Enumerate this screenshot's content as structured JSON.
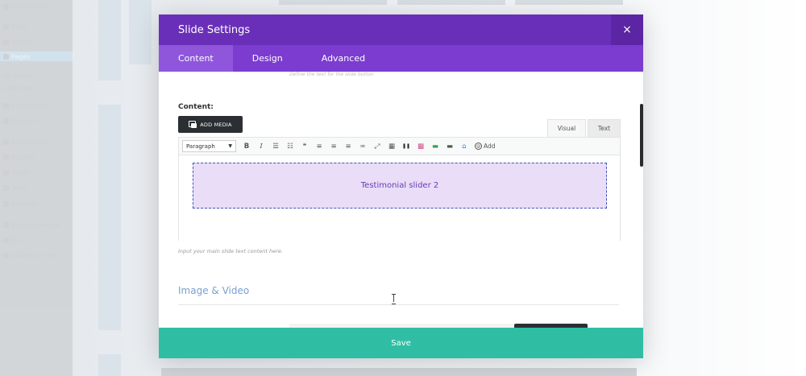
{
  "wp_menu": [
    {
      "label": "Dashboard"
    },
    {
      "label": "Posts"
    },
    {
      "label": "Media"
    },
    {
      "label": "Pages"
    },
    {
      "label": "All Pages"
    },
    {
      "label": "Add New"
    },
    {
      "label": "Comments"
    },
    {
      "label": "Projects"
    },
    {
      "label": "Appearance"
    },
    {
      "label": "Plugins"
    },
    {
      "label": "Users"
    },
    {
      "label": "Tools"
    },
    {
      "label": "Settings"
    },
    {
      "label": "WooCommerce"
    },
    {
      "label": "Divi"
    },
    {
      "label": "Collapse menu"
    }
  ],
  "modal": {
    "title": "Slide Settings",
    "close_glyph": "×",
    "tabs": [
      {
        "label": "Content"
      },
      {
        "label": "Design"
      },
      {
        "label": "Advanced"
      }
    ],
    "faded_description": "Define the text for the slide button",
    "content_label": "Content:",
    "add_media_label": "ADD MEDIA",
    "editor_tabs": {
      "visual": "Visual",
      "text": "Text"
    },
    "toolbar": {
      "format_select": "Paragraph",
      "buttons": [
        {
          "name": "bold-icon",
          "glyph": "B"
        },
        {
          "name": "italic-icon",
          "glyph": "I"
        },
        {
          "name": "bullet-list-icon",
          "glyph": "☰"
        },
        {
          "name": "numbered-list-icon",
          "glyph": "☷"
        },
        {
          "name": "blockquote-icon",
          "glyph": "❝"
        },
        {
          "name": "align-left-icon",
          "glyph": "≡"
        },
        {
          "name": "align-center-icon",
          "glyph": "≡"
        },
        {
          "name": "align-right-icon",
          "glyph": "≡"
        },
        {
          "name": "link-icon",
          "glyph": "∞"
        },
        {
          "name": "fullscreen-icon",
          "glyph": "⤢"
        },
        {
          "name": "toolbar-toggle-icon",
          "glyph": "▦"
        },
        {
          "name": "shortcode-icon",
          "glyph": "❚❚"
        },
        {
          "name": "layout-icon",
          "glyph": "▩"
        },
        {
          "name": "color-bar-icon",
          "glyph": "▬"
        },
        {
          "name": "divider-icon",
          "glyph": "▬"
        },
        {
          "name": "lock-icon",
          "glyph": "⌂"
        }
      ],
      "add_label": "Add"
    },
    "slider_text": "Testimonial slider 2",
    "help_text": "Input your main slide text content here.",
    "section_title": "Image & Video",
    "save_label": "Save"
  },
  "colors": {
    "header": "#6a2fb8",
    "tabs": "#7c3cd0",
    "active_tab": "#8f56dc",
    "save": "#2fbea4",
    "slider_bg": "#e9ddf8",
    "slider_border": "#4452b8"
  }
}
